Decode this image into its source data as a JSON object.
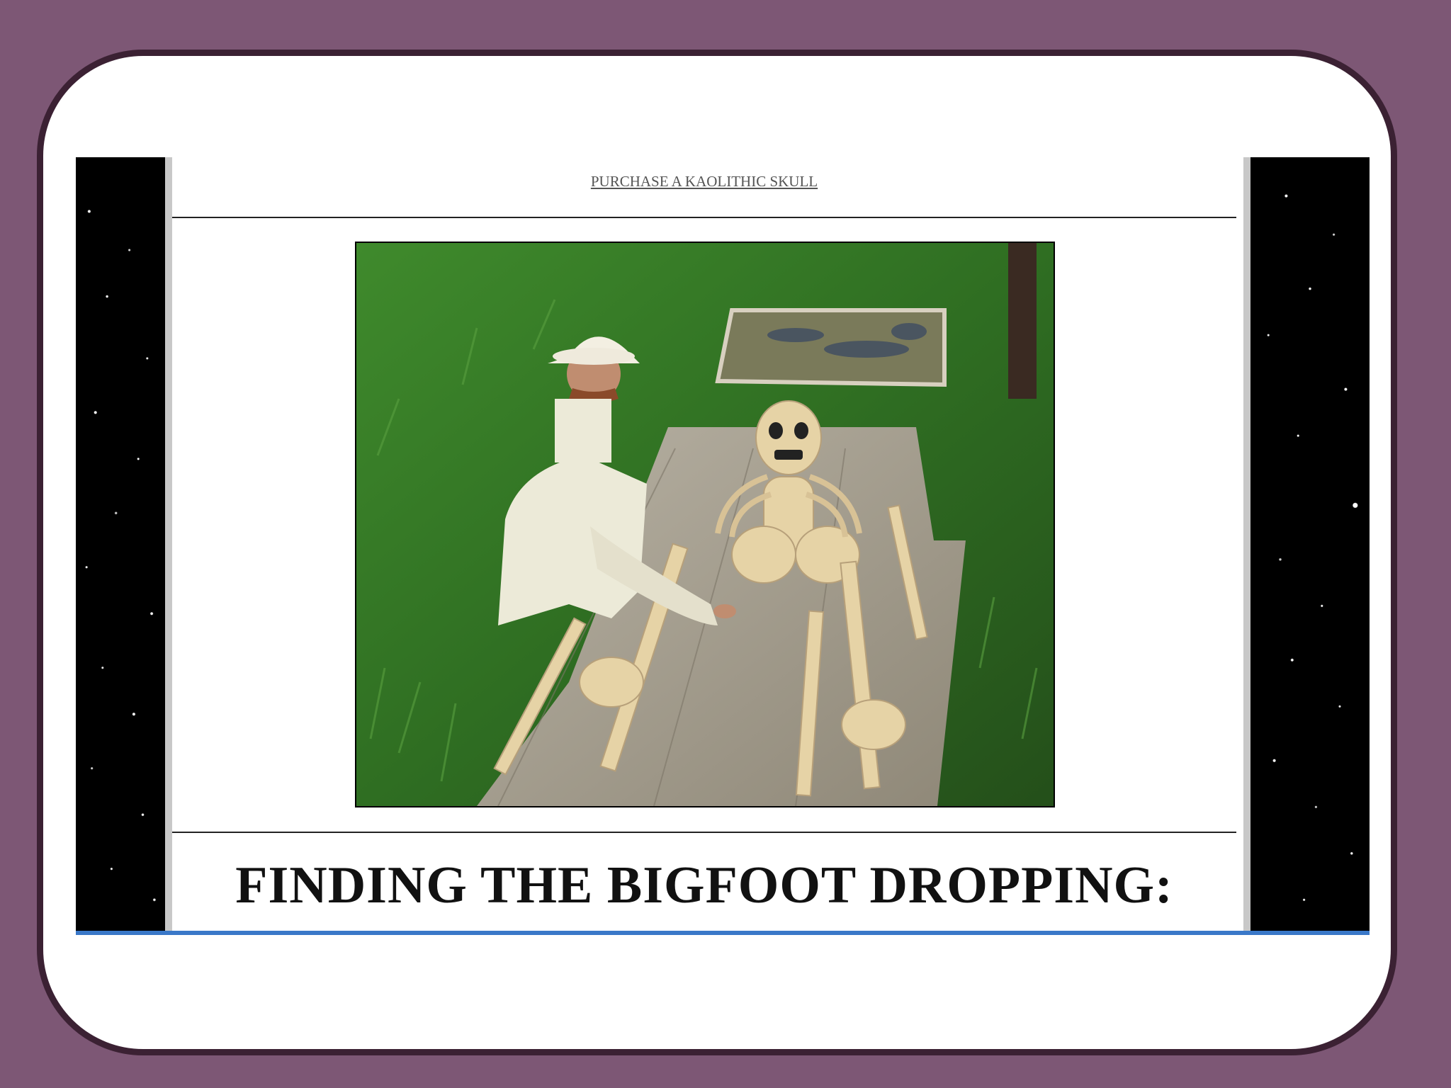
{
  "nav": {
    "purchase_link": "PURCHASE A KAOLITHIC SKULL"
  },
  "main": {
    "heading": "FINDING THE BIGFOOT DROPPING:"
  },
  "photo": {
    "subject": "man in white pith helmet and coat kneeling beside skeleton on wooden board in grass"
  },
  "colors": {
    "background": "#7d5775",
    "frame_border": "#3b2133",
    "accent_line": "#3a78c8"
  }
}
